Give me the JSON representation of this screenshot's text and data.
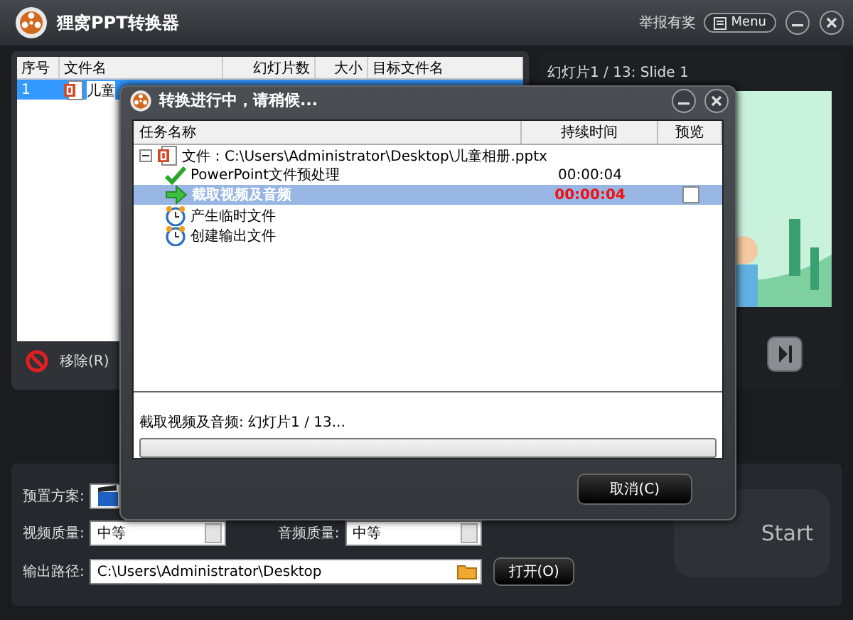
{
  "app": {
    "title": "狸窝PPT转换器",
    "report_link": "举报有奖",
    "menu_button": "Menu"
  },
  "file_list": {
    "columns": [
      "序号",
      "文件名",
      "幻灯片数",
      "大小",
      "目标文件名"
    ],
    "rows": [
      {
        "index": "1",
        "name": "儿童",
        "selected": true
      }
    ],
    "remove_button": "移除(R)"
  },
  "preview": {
    "caption": "幻灯片1 / 13: Slide 1"
  },
  "settings": {
    "preset_label": "预置方案:",
    "video_quality_label": "视频质量:",
    "video_quality": "中等",
    "audio_quality_label": "音频质量:",
    "audio_quality": "中等",
    "output_label": "输出路径:",
    "output_path": "C:\\Users\\Administrator\\Desktop",
    "open_button": "打开(O)",
    "start_button": "Start"
  },
  "dialog": {
    "title": "转换进行中，请稍候...",
    "columns": [
      "任务名称",
      "持续时间",
      "预览"
    ],
    "tree": {
      "label": "文件：C:\\Users\\Administrator\\Desktop\\儿童相册.pptx",
      "expanded": true,
      "children": [
        {
          "kind": "done",
          "name": "PowerPoint文件预处理",
          "duration": "00:00:04",
          "selected": false
        },
        {
          "kind": "running",
          "name": "截取视频及音频",
          "duration": "00:00:04",
          "preview_checked": false,
          "selected": true
        },
        {
          "kind": "pending",
          "name": "产生临时文件",
          "selected": false
        },
        {
          "kind": "pending",
          "name": "创建输出文件",
          "selected": false
        }
      ]
    },
    "progress_text": "截取视频及音频: 幻灯片1 / 13...",
    "progress": {
      "level": 0
    },
    "cancel_button": "取消(C)"
  }
}
